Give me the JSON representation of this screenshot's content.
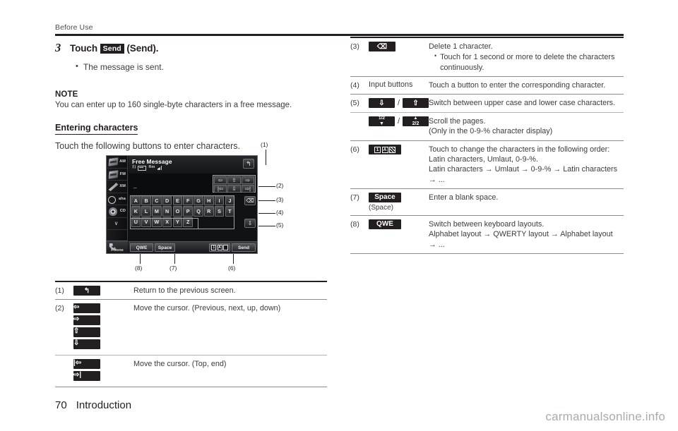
{
  "header": {
    "running_head": "Before Use"
  },
  "step": {
    "number": "3",
    "text_before": "Touch",
    "key_label": "Send",
    "text_after": "(Send).",
    "bullet": "The message is sent."
  },
  "note": {
    "title": "NOTE",
    "body": "You can enter up to 160 single-byte characters in a free message."
  },
  "section": {
    "heading": "Entering characters",
    "intro": "Touch the following buttons to enter characters."
  },
  "device": {
    "title": "Free Message",
    "status": {
      "bluetooth": "",
      "roam": "Rm"
    },
    "entry_text": "_",
    "back_icon": "↰",
    "rail": [
      {
        "label": "AM",
        "icon": "cassette-icon"
      },
      {
        "label": "FM",
        "icon": "cassette-icon"
      },
      {
        "label": "XM",
        "icon": "tuning-fork-icon"
      },
      {
        "label": "aha",
        "icon": "aha-icon"
      },
      {
        "label": "CD",
        "icon": "cd-disc-icon"
      },
      {
        "label": "",
        "icon": "chevron-down-icon"
      }
    ],
    "rail_phone_label": "Phone",
    "cursor_pad": [
      "⇦",
      "⇧",
      "⇨",
      "|⇦",
      "⇩",
      "⇨|"
    ],
    "keys_row1": [
      "A",
      "B",
      "C",
      "D",
      "E",
      "F",
      "G",
      "H",
      "I",
      "J"
    ],
    "keys_row2": [
      "K",
      "L",
      "M",
      "N",
      "O",
      "P",
      "Q",
      "R",
      "S",
      "T"
    ],
    "keys_row3": [
      "U",
      "V",
      "W",
      "X",
      "Y",
      "Z"
    ],
    "delete_icon": "⌫",
    "shift_icon": "⇩",
    "bottom": {
      "qwe": "QWE",
      "space": "Space",
      "mode_cells": [
        "1",
        "A",
        ""
      ],
      "send": "Send"
    },
    "callouts": [
      "(1)",
      "(2)",
      "(3)",
      "(4)",
      "(5)",
      "(6)",
      "(7)",
      "(8)"
    ]
  },
  "table_left": [
    {
      "index": "(1)",
      "buttons": [
        {
          "type": "icon",
          "glyph": "↰",
          "name": "return-button"
        }
      ],
      "desc": "Return to the previous screen."
    },
    {
      "index": "(2)",
      "buttons": [
        {
          "type": "icon",
          "glyph": "⇦",
          "name": "cursor-left-button"
        },
        {
          "type": "icon",
          "glyph": "⇨",
          "name": "cursor-right-button"
        },
        {
          "type": "icon",
          "glyph": "⇧",
          "name": "cursor-up-button"
        },
        {
          "type": "icon",
          "glyph": "⇩",
          "name": "cursor-down-button"
        }
      ],
      "desc": "Move the cursor. (Previous, next, up, down)"
    },
    {
      "index": "",
      "buttons": [
        {
          "type": "icon",
          "glyph": "|⇦",
          "name": "cursor-top-button"
        },
        {
          "type": "icon",
          "glyph": "⇨|",
          "name": "cursor-end-button"
        }
      ],
      "desc": "Move the cursor. (Top, end)"
    }
  ],
  "table_right": [
    {
      "index": "(3)",
      "button_kind": "delete",
      "button_glyph": "⌫",
      "desc": "Delete 1 character.",
      "sub": "Touch for 1 second or more to delete the characters continuously."
    },
    {
      "index": "(4)",
      "button_kind": "text-plain",
      "button_label": "Input buttons",
      "desc": "Touch a button to enter the corresponding character."
    },
    {
      "index": "(5)",
      "button_kind": "pair-arrows",
      "button_glyph_a": "⇩",
      "button_glyph_b": "⇧",
      "desc": "Switch between upper case and lower case characters."
    },
    {
      "index": "",
      "button_kind": "pair-pages",
      "page_a_top": "1/2",
      "page_a_bottom": "▼",
      "page_b_top": "▲",
      "page_b_bottom": "2/2",
      "desc": "Scroll the pages.",
      "desc2": "(Only in the 0-9-% character display)"
    },
    {
      "index": "(6)",
      "button_kind": "mode",
      "mode_cells": [
        "1",
        "A",
        ""
      ],
      "desc": "Touch to change the characters in the following order:",
      "desc2": "Latin characters, Umlaut, 0-9-%.",
      "desc3": "Latin characters → Umlaut → 0-9-% → Latin characters",
      "desc4": "→ ..."
    },
    {
      "index": "(7)",
      "button_kind": "label",
      "button_label": "Space",
      "button_sub": "(Space)",
      "desc": "Enter a blank space."
    },
    {
      "index": "(8)",
      "button_kind": "label",
      "button_label": "QWE",
      "desc": "Switch between keyboard layouts.",
      "desc2": "Alphabet layout → QWERTY layout → Alphabet layout",
      "desc3": "→ ..."
    }
  ],
  "footer": {
    "page_number": "70",
    "section": "Introduction"
  },
  "watermark": "carmanualsonline.info"
}
